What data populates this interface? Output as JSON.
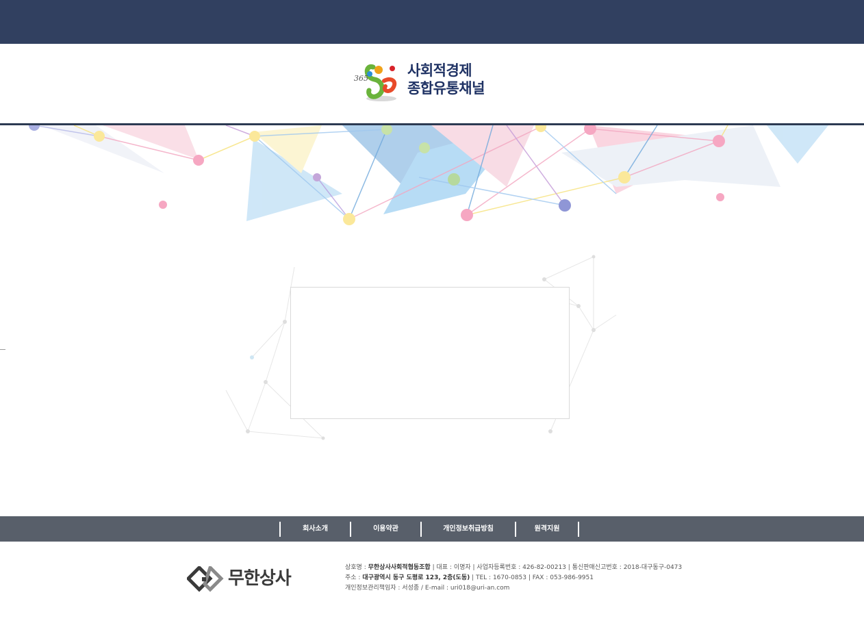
{
  "header": {
    "logo_line1": "사회적경제",
    "logo_line2": "종합유통채널",
    "logo_mark_text": "365"
  },
  "footer_nav": {
    "items": [
      {
        "label": "회사소개"
      },
      {
        "label": "이용약관"
      },
      {
        "label": "개인정보취급방침"
      },
      {
        "label": "원격지원"
      }
    ]
  },
  "footer": {
    "company_logo_text": "무한상사",
    "line1": {
      "company_label": "상호명 :",
      "company_value": "무한상사사회적협동조합",
      "ceo_label": "| 대표 :",
      "ceo_value": "이명자",
      "bizno_label": "| 사업자등록번호 :",
      "bizno_value": "426-82-00213",
      "mailorder_label": "| 통신판매신고번호 :",
      "mailorder_value": "2018-대구동구-0473"
    },
    "line2": {
      "address_label": "주소 :",
      "address_value": "대구광역시 동구 도평로 123, 2층(도동)",
      "tel_label": "| TEL :",
      "tel_value": "1670-0853",
      "fax_label": "| FAX :",
      "fax_value": "053-986-9951"
    },
    "line3": {
      "privacy_label": "개인정보관리책임자 :",
      "privacy_value": "서성종",
      "email_label": "/ E-mail :",
      "email_value": "uri018@uri-an.com"
    }
  },
  "colors": {
    "top_bar": "#314060",
    "nav_bar": "#585f6a",
    "logo_text": "#1f3264"
  }
}
